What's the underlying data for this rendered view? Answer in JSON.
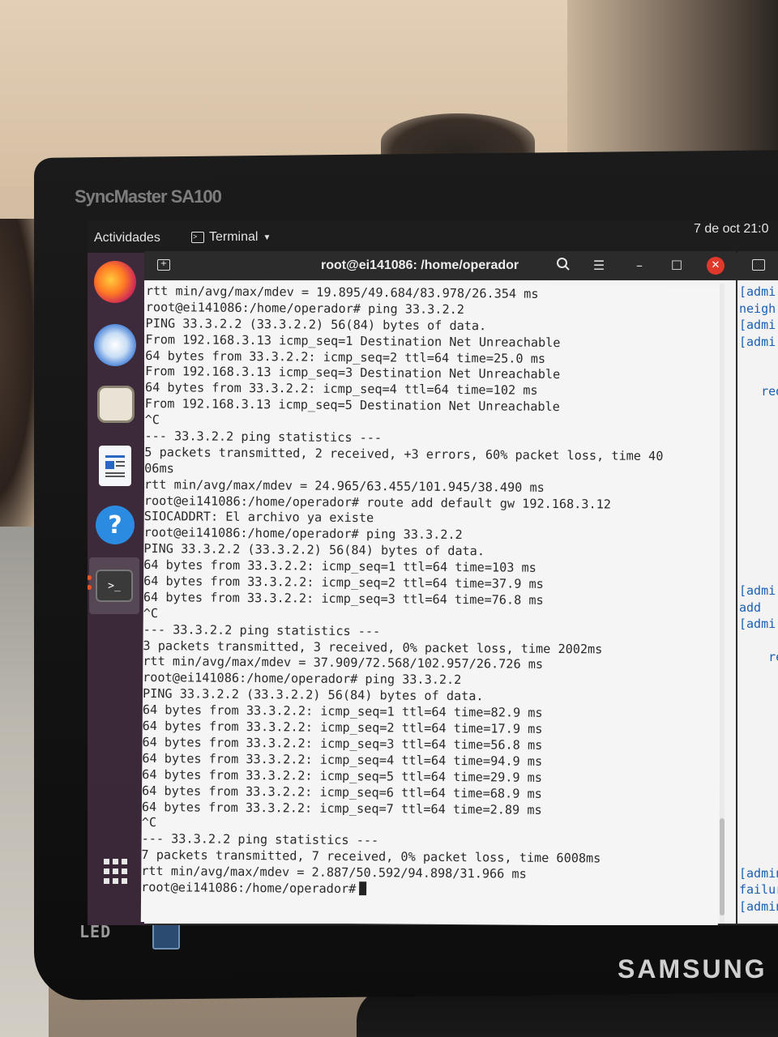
{
  "monitor": {
    "model": "SyncMaster SA100",
    "brand": "SAMSUNG",
    "led": "LED"
  },
  "topbar": {
    "activities": "Actividades",
    "app_menu": "Terminal",
    "clock": "7 de oct 21:0"
  },
  "dock": {
    "items": [
      "firefox-icon",
      "thunderbird-icon",
      "files-icon",
      "writer-icon",
      "help-icon",
      "terminal-icon",
      "show-apps-icon"
    ],
    "help_glyph": "?",
    "terminal_glyph": ">_"
  },
  "terminal": {
    "title": "root@ei141086: /home/operador",
    "lines": [
      "rtt min/avg/max/mdev = 19.895/49.684/83.978/26.354 ms",
      "root@ei141086:/home/operador# ping 33.3.2.2",
      "PING 33.3.2.2 (33.3.2.2) 56(84) bytes of data.",
      "From 192.168.3.13 icmp_seq=1 Destination Net Unreachable",
      "64 bytes from 33.3.2.2: icmp_seq=2 ttl=64 time=25.0 ms",
      "From 192.168.3.13 icmp_seq=3 Destination Net Unreachable",
      "64 bytes from 33.3.2.2: icmp_seq=4 ttl=64 time=102 ms",
      "From 192.168.3.13 icmp_seq=5 Destination Net Unreachable",
      "^C",
      "--- 33.3.2.2 ping statistics ---",
      "5 packets transmitted, 2 received, +3 errors, 60% packet loss, time 40",
      "06ms",
      "rtt min/avg/max/mdev = 24.965/63.455/101.945/38.490 ms",
      "root@ei141086:/home/operador# route add default gw 192.168.3.12",
      "SIOCADDRT: El archivo ya existe",
      "root@ei141086:/home/operador# ping 33.3.2.2",
      "PING 33.3.2.2 (33.3.2.2) 56(84) bytes of data.",
      "64 bytes from 33.3.2.2: icmp_seq=1 ttl=64 time=103 ms",
      "64 bytes from 33.3.2.2: icmp_seq=2 ttl=64 time=37.9 ms",
      "64 bytes from 33.3.2.2: icmp_seq=3 ttl=64 time=76.8 ms",
      "^C",
      "--- 33.3.2.2 ping statistics ---",
      "3 packets transmitted, 3 received, 0% packet loss, time 2002ms",
      "rtt min/avg/max/mdev = 37.909/72.568/102.957/26.726 ms",
      "root@ei141086:/home/operador# ping 33.3.2.2",
      "PING 33.3.2.2 (33.3.2.2) 56(84) bytes of data.",
      "64 bytes from 33.3.2.2: icmp_seq=1 ttl=64 time=82.9 ms",
      "64 bytes from 33.3.2.2: icmp_seq=2 ttl=64 time=17.9 ms",
      "64 bytes from 33.3.2.2: icmp_seq=3 ttl=64 time=56.8 ms",
      "64 bytes from 33.3.2.2: icmp_seq=4 ttl=64 time=94.9 ms",
      "64 bytes from 33.3.2.2: icmp_seq=5 ttl=64 time=29.9 ms",
      "64 bytes from 33.3.2.2: icmp_seq=6 ttl=64 time=68.9 ms",
      "64 bytes from 33.3.2.2: icmp_seq=7 ttl=64 time=2.89 ms",
      "^C",
      "--- 33.3.2.2 ping statistics ---",
      "7 packets transmitted, 7 received, 0% packet loss, time 6008ms",
      "rtt min/avg/max/mdev = 2.887/50.592/94.898/31.966 ms"
    ],
    "prompt": "root@ei141086:/home/operador#"
  },
  "terminal2": {
    "lines": [
      "[admi",
      "neigh",
      "[admi",
      "[admi",
      "",
      "",
      "   red",
      "",
      "",
      "",
      "",
      "",
      "",
      "",
      "",
      "",
      "",
      "",
      "[admi",
      "add  (",
      "[admi",
      "",
      "    red",
      "",
      "",
      "",
      "",
      "",
      "",
      "",
      "",
      "",
      "",
      "",
      "",
      "[admin",
      "failur",
      "[admin"
    ]
  },
  "colors": {
    "dock": "#3a2838",
    "close": "#e0382a",
    "terminal_bg": "#f5f5f5"
  }
}
